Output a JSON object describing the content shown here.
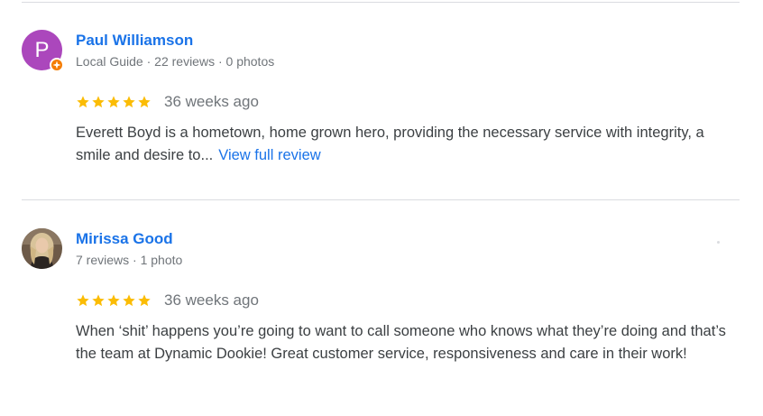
{
  "colors": {
    "link": "#1a73e8",
    "star": "#fbbc04",
    "avatar_p": "#ab47bc",
    "local_guide_badge": "#f57c00"
  },
  "reviews": [
    {
      "avatar_letter": "P",
      "avatar_type": "letter",
      "local_guide_badge": "local-guide-star-icon",
      "name": "Paul Williamson",
      "meta": "Local Guide · 22 reviews · 0 photos",
      "rating": 5,
      "time": "36 weeks ago",
      "text": "Everett Boyd is a hometown, home grown hero, providing the necessary service with integrity, a smile and desire to...",
      "more_label": "View full review"
    },
    {
      "avatar_type": "photo",
      "name": "Mirissa Good",
      "meta": "7 reviews · 1 photo",
      "rating": 5,
      "time": "36 weeks ago",
      "text": "When ‘shit’ happens you’re going to want to call someone who knows what they’re doing and that’s the team at Dynamic Dookie! Great customer service, responsiveness and care in their work!"
    }
  ]
}
